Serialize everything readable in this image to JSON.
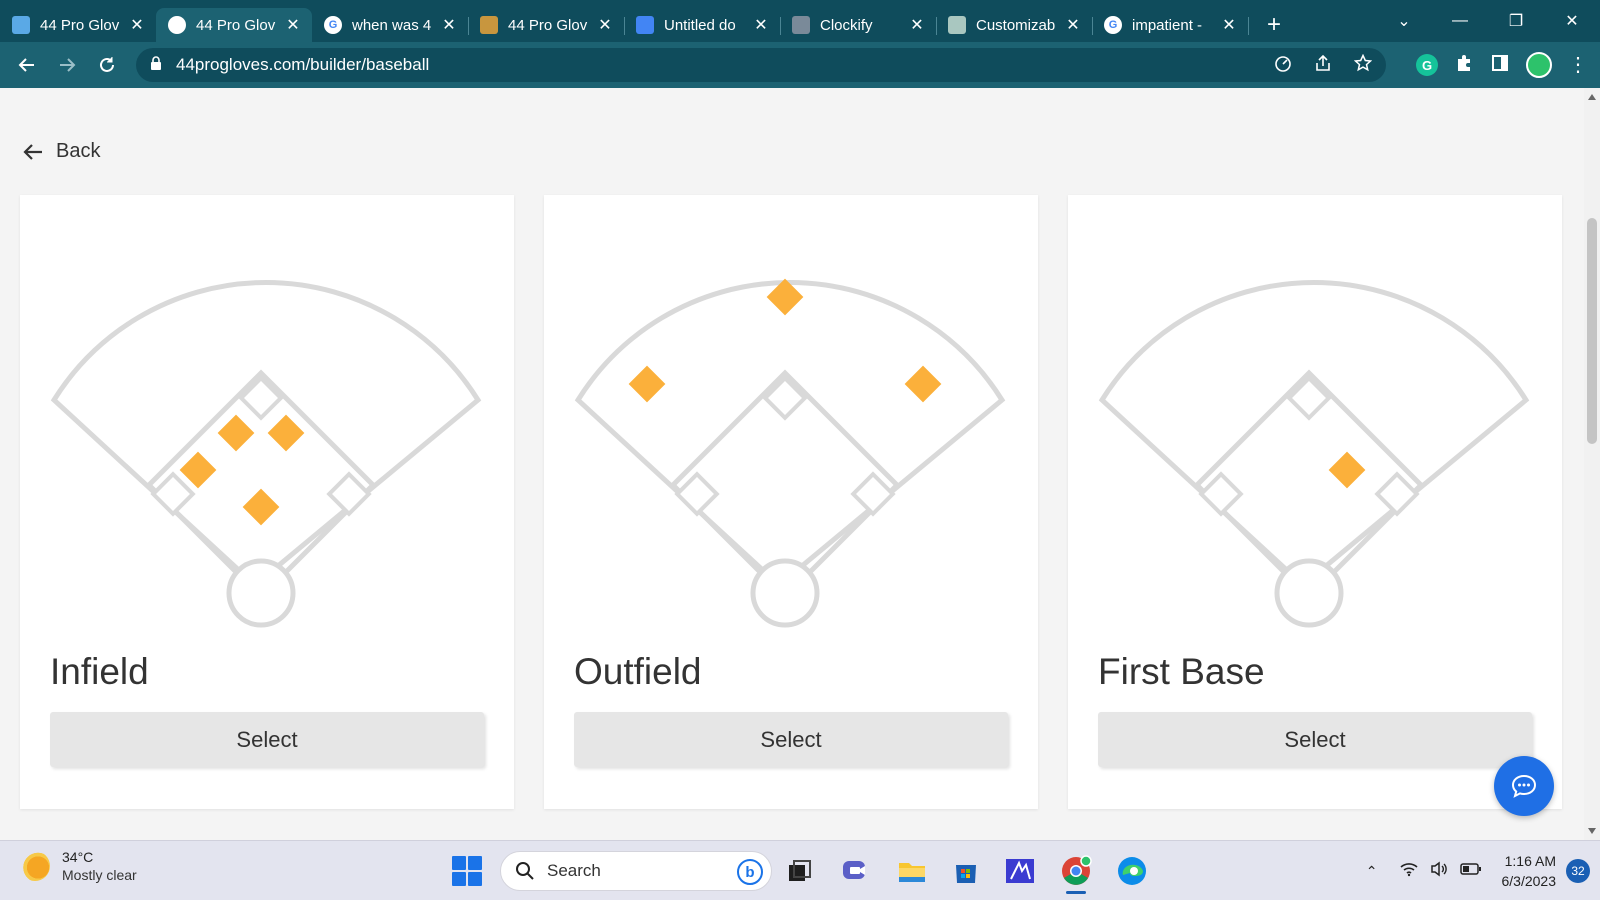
{
  "browser": {
    "tabs": [
      {
        "title": "44 Pro Glov",
        "favicon": "trello-icon",
        "color": "#5aa9e6"
      },
      {
        "title": "44 Pro Glov",
        "favicon": "globe-icon",
        "color": "#ffffff",
        "active": true
      },
      {
        "title": "when was 4",
        "favicon": "google-icon",
        "color": "#ffffff"
      },
      {
        "title": "44 Pro Glov",
        "favicon": "glove-icon",
        "color": "#c8963e"
      },
      {
        "title": "Untitled do",
        "favicon": "docs-icon",
        "color": "#4285f4"
      },
      {
        "title": "Clockify",
        "favicon": "clockify-icon",
        "color": "#7a8a99"
      },
      {
        "title": "Customizab",
        "favicon": "openai-icon",
        "color": "#a9c7c0"
      },
      {
        "title": "impatient -",
        "favicon": "google-icon",
        "color": "#ffffff"
      }
    ],
    "url": "44progloves.com/builder/baseball"
  },
  "page": {
    "back_label": "Back",
    "cards": [
      {
        "name": "Infield",
        "select_label": "Select",
        "highlight": "infield"
      },
      {
        "name": "Outfield",
        "select_label": "Select",
        "highlight": "outfield"
      },
      {
        "name": "First Base",
        "select_label": "Select",
        "highlight": "first-base"
      }
    ]
  },
  "colors": {
    "accent": "#fbb03b",
    "field_line": "#d9d9d9",
    "chrome_dark": "#0f4c5c",
    "chrome_light": "#1c6272",
    "chat_button": "#1f6fe5"
  },
  "taskbar": {
    "weather_temp": "34°C",
    "weather_desc": "Mostly clear",
    "search_placeholder": "Search",
    "time": "1:16 AM",
    "date": "6/3/2023",
    "notification_count": "32"
  }
}
